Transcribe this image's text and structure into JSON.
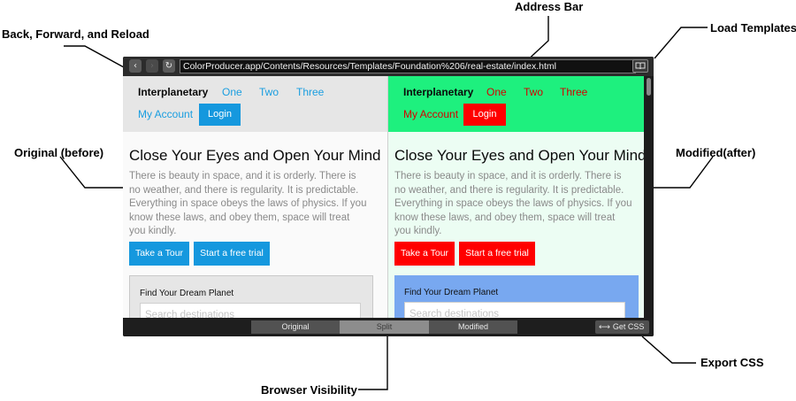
{
  "callouts": {
    "address_bar": "Address Bar",
    "back_forward_reload": "Back, Forward, and Reload",
    "load_templates": "Load Templates",
    "original_before": "Original (before)",
    "modified_after": "Modified(after)",
    "export_css": "Export CSS",
    "browser_visibility": "Browser Visibility"
  },
  "toolbar": {
    "back_icon": "chevron-left-icon",
    "forward_icon": "chevron-right-icon",
    "reload_icon": "reload-icon",
    "url": "ColorProducer.app/Contents/Resources/Templates/Foundation%206/real-estate/index.html",
    "templates_icon": "book-icon"
  },
  "page": {
    "brand": "Interplanetary",
    "nav": [
      "One",
      "Two",
      "Three"
    ],
    "my_account": "My Account",
    "login": "Login",
    "headline": "Close Your Eyes and Open Your Mind",
    "paragraph": "There is beauty in space, and it is orderly. There is no weather, and there is regularity. It is predictable. Everything in space obeys the laws of physics. If you know these laws, and obey them, space will treat you kindly.",
    "tour_button": "Take a Tour",
    "trial_button": "Start a free trial",
    "panel_title": "Find Your Dream Planet",
    "search_placeholder": "Search destinations"
  },
  "bottombar": {
    "tabs": [
      "Original",
      "Split",
      "Modified"
    ],
    "selected": "Split",
    "get_css": "Get CSS",
    "get_css_icon": "code-arrows-icon"
  },
  "colors": {
    "original_accent": "#1598de",
    "modified_accent": "#ff0000",
    "modified_topbar": "#1ef07e",
    "modified_panel": "#78a8f0"
  }
}
